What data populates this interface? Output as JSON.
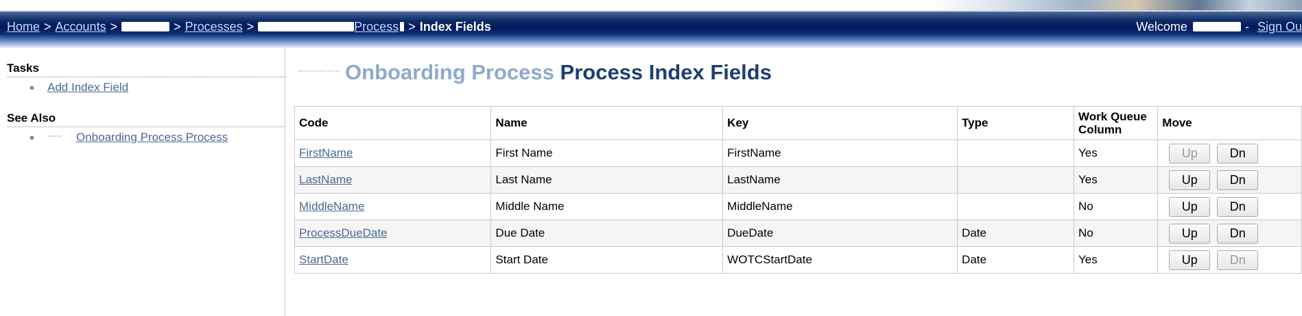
{
  "breadcrumb": {
    "home": "Home",
    "accounts": "Accounts",
    "processes": "Processes",
    "process_suffix": "Process",
    "current": "Index Fields",
    "separator": ">"
  },
  "user": {
    "welcome": "Welcome",
    "dash": "-",
    "sign_out": "Sign Ou"
  },
  "sidebar": {
    "tasks_heading": "Tasks",
    "tasks": [
      {
        "label": "Add Index Field"
      }
    ],
    "see_also_heading": "See Also",
    "see_also": [
      {
        "label": "Onboarding Process Process"
      }
    ]
  },
  "page": {
    "title_light": "Onboarding Process",
    "title_dark": "Process Index Fields"
  },
  "table": {
    "headers": {
      "code": "Code",
      "name": "Name",
      "key": "Key",
      "type": "Type",
      "wq_line1": "Work Queue",
      "wq_line2": "Column",
      "move": "Move"
    },
    "up_label": "Up",
    "dn_label": "Dn",
    "rows": [
      {
        "code": "FirstName",
        "name": "First Name",
        "key": "FirstName",
        "type": "",
        "wq": "Yes",
        "up_enabled": false,
        "dn_enabled": true
      },
      {
        "code": "LastName",
        "name": "Last Name",
        "key": "LastName",
        "type": "",
        "wq": "Yes",
        "up_enabled": true,
        "dn_enabled": true
      },
      {
        "code": "MiddleName",
        "name": "Middle Name",
        "key": "MiddleName",
        "type": "",
        "wq": "No",
        "up_enabled": true,
        "dn_enabled": true
      },
      {
        "code": "ProcessDueDate",
        "name": "Due Date",
        "key": "DueDate",
        "type": "Date",
        "wq": "No",
        "up_enabled": true,
        "dn_enabled": true
      },
      {
        "code": "StartDate",
        "name": "Start Date",
        "key": "WOTCStartDate",
        "type": "Date",
        "wq": "Yes",
        "up_enabled": true,
        "dn_enabled": false
      }
    ]
  },
  "colors": {
    "link": "#4a6890",
    "title_light": "#8eaacb",
    "title_dark": "#1c3f72",
    "nav_dark": "#001a5a"
  }
}
